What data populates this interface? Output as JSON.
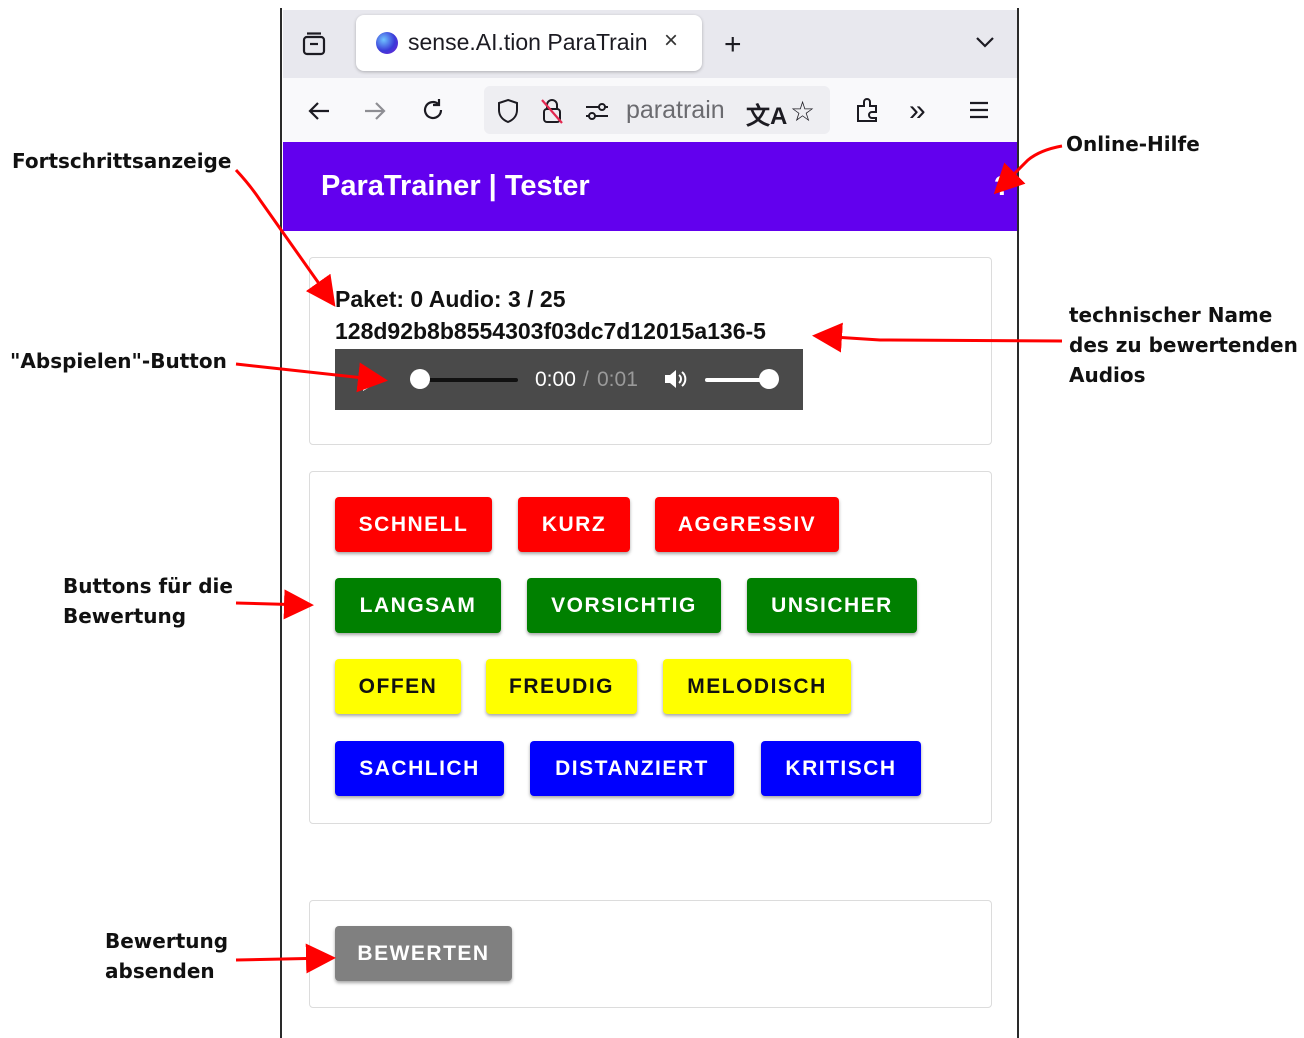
{
  "browser": {
    "tab_title": "sense.AI.tion ParaTrain",
    "tab_close": "×",
    "new_tab": "+",
    "url": "paratrain"
  },
  "app": {
    "title": "ParaTrainer | Tester",
    "help": "?"
  },
  "audio": {
    "progress": "Paket: 0 Audio: 3 / 25",
    "name": "128d92b8b8554303f03dc7d12015a136-5",
    "time_current": "0:00",
    "time_separator": "/",
    "time_duration": "0:01"
  },
  "rating_buttons": [
    {
      "label": "SCHNELL",
      "color": "#ff0000"
    },
    {
      "label": "KURZ",
      "color": "#ff0000"
    },
    {
      "label": "AGGRESSIV",
      "color": "#ff0000"
    },
    {
      "label": "LANGSAM",
      "color": "#008000"
    },
    {
      "label": "VORSICHTIG",
      "color": "#008000"
    },
    {
      "label": "UNSICHER",
      "color": "#008000"
    },
    {
      "label": "OFFEN",
      "color": "#ffff00"
    },
    {
      "label": "FREUDIG",
      "color": "#ffff00"
    },
    {
      "label": "MELODISCH",
      "color": "#ffff00"
    },
    {
      "label": "SACHLICH",
      "color": "#0000ff"
    },
    {
      "label": "DISTANZIERT",
      "color": "#0000ff"
    },
    {
      "label": "KRITISCH",
      "color": "#0000ff"
    }
  ],
  "submit": {
    "label": "BEWERTEN",
    "color": "#808080"
  },
  "annotations": {
    "progress": "Fortschrittsanzeige",
    "play": "\"Abspielen\"-Button",
    "buttons_line1": "Buttons für die",
    "buttons_line2": "Bewertung",
    "submit_line1": "Bewertung",
    "submit_line2": "absenden",
    "help": "Online-Hilfe",
    "name_line1": "technischer Name",
    "name_line2": "des zu bewertenden",
    "name_line3": "Audios"
  },
  "colors": {
    "appbar": "#6200ee",
    "annotation_arrow": "#ff0000"
  }
}
